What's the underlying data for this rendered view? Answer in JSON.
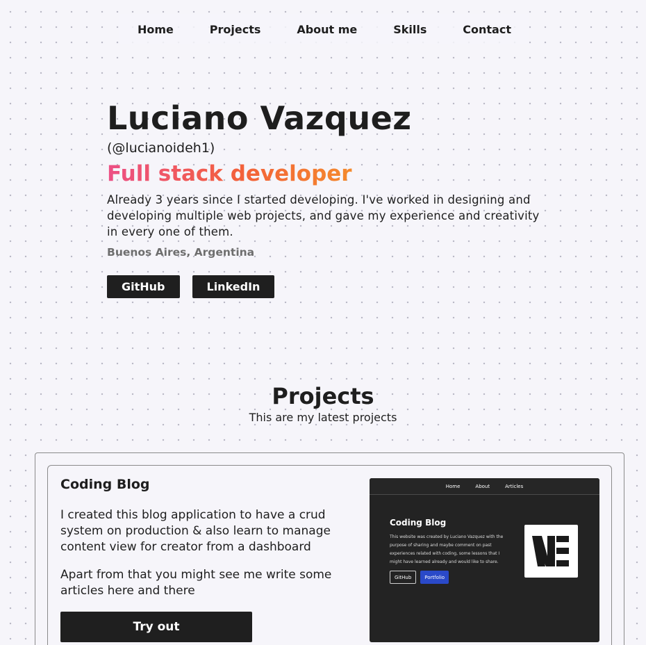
{
  "nav": {
    "items": [
      "Home",
      "Projects",
      "About me",
      "Skills",
      "Contact"
    ]
  },
  "hero": {
    "name": "Luciano Vazquez",
    "handle": "(@lucianoideh1)",
    "role": "Full stack developer",
    "bio": "Already 3 years since I started developing. I've worked in designing and developing multiple web projects, and gave my experience and creativity in every one of them.",
    "location": "Buenos Aires, Argentina",
    "github_label": "GitHub",
    "linkedin_label": "LinkedIn"
  },
  "projects": {
    "title": "Projects",
    "subtitle": "This are my latest projects",
    "items": [
      {
        "title": "Coding Blog",
        "desc1": "I created this blog application to have a crud system on production & also learn to manage content view for creator from a dashboard",
        "desc2": "Apart from that you might see me write some articles here and there",
        "button": "Try out",
        "preview": {
          "nav": [
            "Home",
            "About",
            "Articles"
          ],
          "title": "Coding Blog",
          "text": "This website was created by Luciano Vazquez with the purpose of sharing and maybe comment on past experiences related with coding, some lessons that I might have learned already and would like to share.",
          "github": "GitHub",
          "portfolio": "Portfolio",
          "logo_text": "VE"
        }
      }
    ]
  },
  "colors": {
    "accent_start": "#ec4f86",
    "accent_end": "#f48a2c",
    "dark": "#1f1f1f",
    "portfolio_blue": "#2a49c8"
  }
}
